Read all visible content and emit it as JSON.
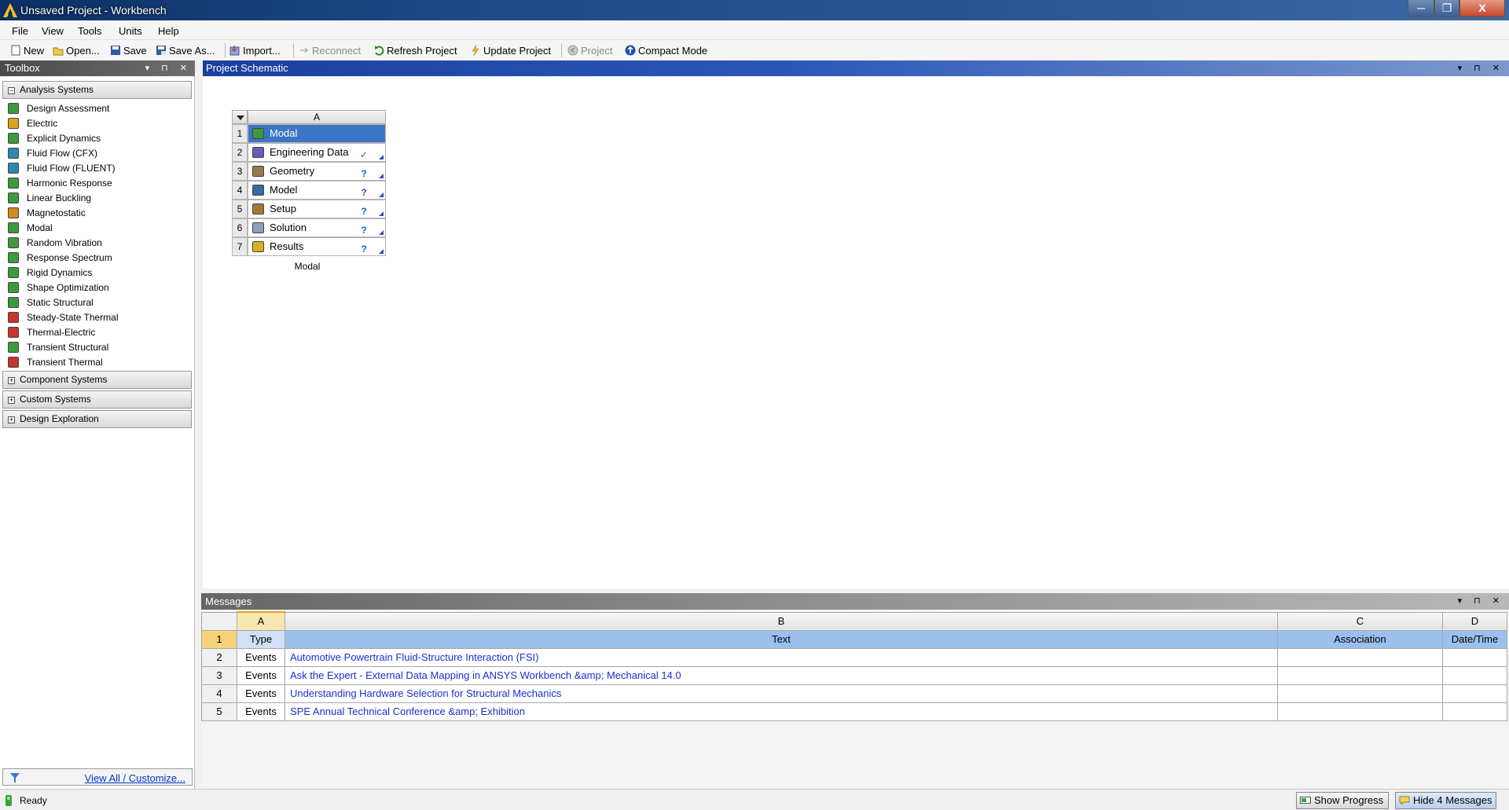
{
  "window": {
    "title": "Unsaved Project - Workbench"
  },
  "menu": [
    "File",
    "View",
    "Tools",
    "Units",
    "Help"
  ],
  "toolbar": {
    "new": "New",
    "open": "Open...",
    "save": "Save",
    "save_as": "Save As...",
    "import": "Import...",
    "reconnect": "Reconnect",
    "refresh": "Refresh Project",
    "update": "Update Project",
    "project": "Project",
    "compact": "Compact Mode"
  },
  "toolbox": {
    "title": "Toolbox",
    "analysis_systems": "Analysis Systems",
    "items": [
      {
        "label": "Design Assessment",
        "icon": "design-assessment-icon"
      },
      {
        "label": "Electric",
        "icon": "electric-icon"
      },
      {
        "label": "Explicit Dynamics",
        "icon": "explicit-dynamics-icon"
      },
      {
        "label": "Fluid Flow (CFX)",
        "icon": "fluid-flow-cfx-icon"
      },
      {
        "label": "Fluid Flow (FLUENT)",
        "icon": "fluid-flow-fluent-icon"
      },
      {
        "label": "Harmonic Response",
        "icon": "harmonic-response-icon"
      },
      {
        "label": "Linear Buckling",
        "icon": "linear-buckling-icon"
      },
      {
        "label": "Magnetostatic",
        "icon": "magnetostatic-icon"
      },
      {
        "label": "Modal",
        "icon": "modal-icon"
      },
      {
        "label": "Random Vibration",
        "icon": "random-vibration-icon"
      },
      {
        "label": "Response Spectrum",
        "icon": "response-spectrum-icon"
      },
      {
        "label": "Rigid Dynamics",
        "icon": "rigid-dynamics-icon"
      },
      {
        "label": "Shape Optimization",
        "icon": "shape-optimization-icon"
      },
      {
        "label": "Static Structural",
        "icon": "static-structural-icon"
      },
      {
        "label": "Steady-State Thermal",
        "icon": "steady-state-thermal-icon"
      },
      {
        "label": "Thermal-Electric",
        "icon": "thermal-electric-icon"
      },
      {
        "label": "Transient Structural",
        "icon": "transient-structural-icon"
      },
      {
        "label": "Transient Thermal",
        "icon": "transient-thermal-icon"
      }
    ],
    "component_systems": "Component Systems",
    "custom_systems": "Custom Systems",
    "design_exploration": "Design Exploration",
    "view_all": "View All / Customize..."
  },
  "schematic": {
    "title": "Project Schematic",
    "system": {
      "column": "A",
      "caption": "Modal",
      "cells": [
        {
          "num": "1",
          "label": "Modal",
          "status": ""
        },
        {
          "num": "2",
          "label": "Engineering Data",
          "status": "✓"
        },
        {
          "num": "3",
          "label": "Geometry",
          "status": "?"
        },
        {
          "num": "4",
          "label": "Model",
          "status": "?"
        },
        {
          "num": "5",
          "label": "Setup",
          "status": "?"
        },
        {
          "num": "6",
          "label": "Solution",
          "status": "?"
        },
        {
          "num": "7",
          "label": "Results",
          "status": "?"
        }
      ]
    }
  },
  "messages": {
    "title": "Messages",
    "columns": [
      "A",
      "B",
      "C",
      "D"
    ],
    "headers": {
      "num": "1",
      "type": "Type",
      "text": "Text",
      "association": "Association",
      "datetime": "Date/Time"
    },
    "rows": [
      {
        "num": "2",
        "type": "Events",
        "text": "Automotive Powertrain Fluid-Structure Interaction (FSI)"
      },
      {
        "num": "3",
        "type": "Events",
        "text": "Ask the Expert - External Data Mapping in ANSYS Workbench &amp; Mechanical 14.0"
      },
      {
        "num": "4",
        "type": "Events",
        "text": "Understanding Hardware Selection for Structural Mechanics"
      },
      {
        "num": "5",
        "type": "Events",
        "text": "SPE Annual Technical Conference &amp; Exhibition"
      }
    ]
  },
  "status": {
    "text": "Ready",
    "show_progress": "Show Progress",
    "hide_messages": "Hide 4 Messages"
  }
}
